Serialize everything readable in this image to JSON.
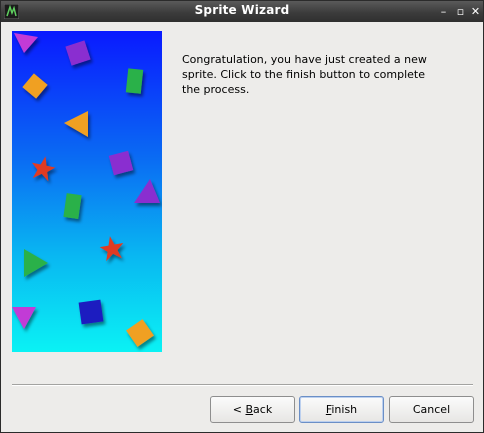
{
  "window": {
    "title": "Sprite Wizard",
    "controls": {
      "minimize": "–",
      "maximize": "▫",
      "close": "✕"
    }
  },
  "banner": {
    "gradient_top": "#0a1aff",
    "gradient_bottom": "#0af2f4",
    "shape_colors": [
      "#c23bd6",
      "#8a2fd0",
      "#f0a020",
      "#2bb14a",
      "#e03a24",
      "#1f1fc0"
    ]
  },
  "content": {
    "message": "Congratulation, you have just created a new\nsprite. Click to the finish button to complete\nthe process."
  },
  "buttons": {
    "back": {
      "prefix": "< ",
      "mnemonic": "B",
      "rest": "ack"
    },
    "finish": {
      "prefix": "",
      "mnemonic": "F",
      "rest": "inish"
    },
    "cancel": {
      "label": "Cancel"
    }
  }
}
